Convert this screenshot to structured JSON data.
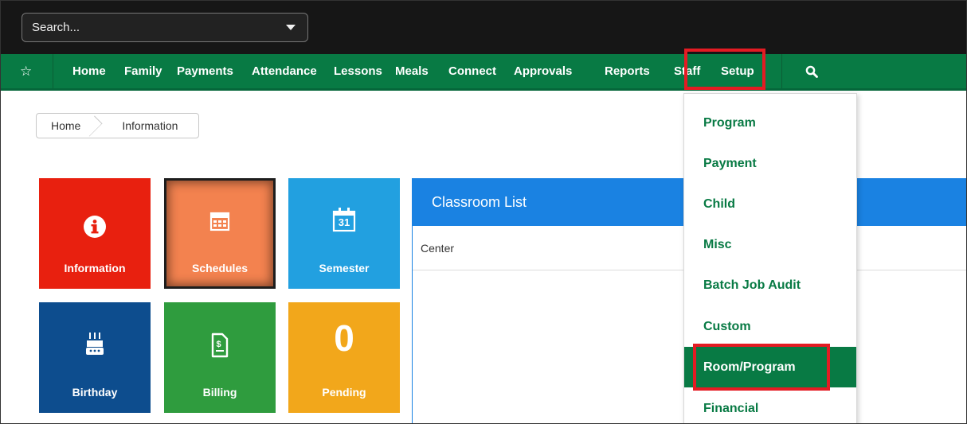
{
  "search": {
    "text": "Search..."
  },
  "nav": {
    "items": [
      {
        "label": "Home"
      },
      {
        "label": "Family"
      },
      {
        "label": "Payments"
      },
      {
        "label": "Attendance"
      },
      {
        "label": "Lessons"
      },
      {
        "label": "Meals"
      },
      {
        "label": "Connect"
      },
      {
        "label": "Approvals"
      },
      {
        "label": "Reports"
      },
      {
        "label": "Staff"
      },
      {
        "label": "Setup"
      }
    ],
    "star_icon": "☆",
    "search_icon": "search-icon"
  },
  "breadcrumb": {
    "home": "Home",
    "current": "Information"
  },
  "tiles": [
    {
      "label": "Information",
      "color": "#e8200f",
      "icon": "info-icon"
    },
    {
      "label": "Schedules",
      "color": "#f3824f",
      "icon": "calendar-icon"
    },
    {
      "label": "Semester",
      "color": "#22a0e0",
      "icon": "calendar-31-icon",
      "icon_text": "31"
    },
    {
      "label": "Birthday",
      "color": "#0d4d8e",
      "icon": "cake-icon"
    },
    {
      "label": "Billing",
      "color": "#2f9c3e",
      "icon": "bill-icon"
    },
    {
      "label": "Pending",
      "color": "#f2a71b",
      "value": "0"
    }
  ],
  "panel": {
    "title": "Classroom List",
    "column": "Center"
  },
  "dropdown": {
    "items": [
      {
        "label": "Program"
      },
      {
        "label": "Payment"
      },
      {
        "label": "Child"
      },
      {
        "label": "Misc"
      },
      {
        "label": "Batch Job Audit"
      },
      {
        "label": "Custom"
      },
      {
        "label": "Room/Program"
      },
      {
        "label": "Financial"
      }
    ],
    "active": "Room/Program"
  },
  "colors": {
    "nav_green": "#087a44",
    "highlight_red": "#e41b23",
    "panel_blue": "#1a82e2"
  }
}
